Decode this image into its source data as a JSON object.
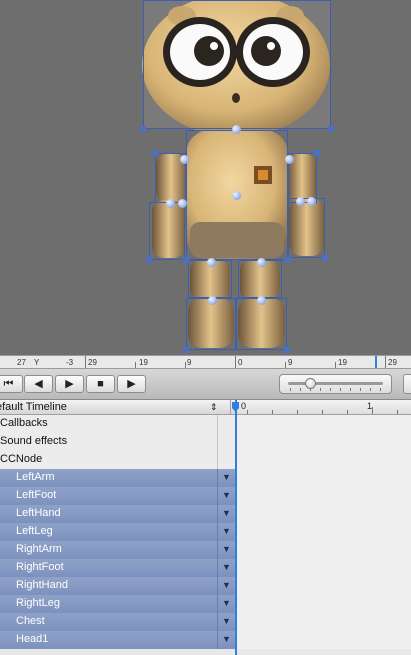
{
  "ruler": {
    "x_label": "27",
    "y_label": "Y",
    "y_value": "-3",
    "ticks": [
      "29",
      "19",
      "9",
      "0",
      "9",
      "19",
      "29"
    ]
  },
  "transport": {
    "buttons": [
      {
        "name": "rewind-to-start-icon",
        "glyph": "⏮"
      },
      {
        "name": "step-back-icon",
        "glyph": "◀"
      },
      {
        "name": "step-forward-icon",
        "glyph": "▶"
      },
      {
        "name": "stop-icon",
        "glyph": "■"
      },
      {
        "name": "play-icon",
        "glyph": "▶"
      }
    ],
    "zoom_level": 0.2
  },
  "timeline": {
    "title": "efault Timeline",
    "sort_arrows": "⇕",
    "ruler_labels": [
      "0",
      "1"
    ],
    "rows": [
      {
        "label": "Callbacks",
        "kind": "top"
      },
      {
        "label": "Sound effects",
        "kind": "top"
      },
      {
        "label": "CCNode",
        "kind": "top"
      },
      {
        "label": "LeftArm",
        "kind": "child"
      },
      {
        "label": "LeftFoot",
        "kind": "child"
      },
      {
        "label": "LeftHand",
        "kind": "child"
      },
      {
        "label": "LeftLeg",
        "kind": "child"
      },
      {
        "label": "RightArm",
        "kind": "child"
      },
      {
        "label": "RightFoot",
        "kind": "child"
      },
      {
        "label": "RightHand",
        "kind": "child"
      },
      {
        "label": "RightLeg",
        "kind": "child"
      },
      {
        "label": "Chest",
        "kind": "child"
      },
      {
        "label": "Head1",
        "kind": "child"
      }
    ],
    "row_arrow": "▼"
  },
  "colors": {
    "selection": "#3d5fb0",
    "playhead": "#2e7fe0",
    "child_row": "#8fa2c8"
  }
}
